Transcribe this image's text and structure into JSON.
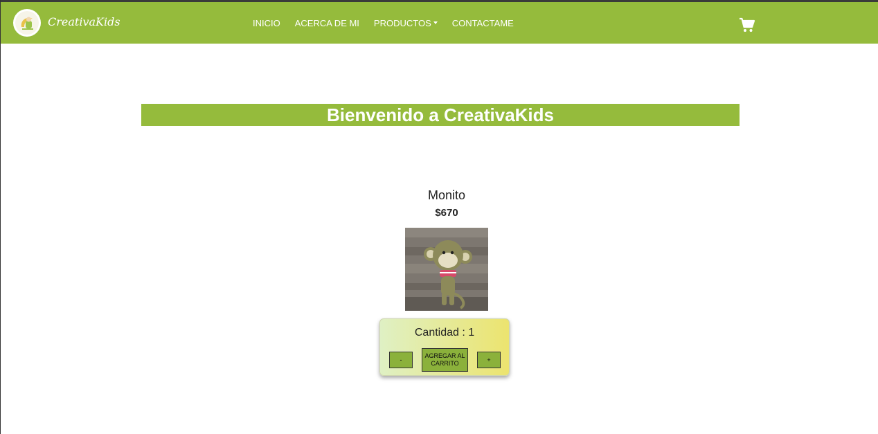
{
  "brand": {
    "name": "CreativaKids"
  },
  "nav": {
    "items": [
      "INICIO",
      "ACERCA DE MI",
      "PRODUCTOS",
      "CONTACTAME"
    ]
  },
  "hero": {
    "title": "Bienvenido a CreativaKids"
  },
  "product": {
    "name": "Monito",
    "price": "$670",
    "quantity_text": "Cantidad : 1",
    "minus_label": "-",
    "add_to_cart_label": "AGREGAR AL CARRITO",
    "plus_label": "+"
  },
  "colors": {
    "brand_green": "#95bb3c",
    "button_green": "#8bb13b",
    "card_gradient_start": "#dff0c4",
    "card_gradient_end": "#ece46f"
  },
  "icons": [
    "logo-icon",
    "chevron-down-icon",
    "shopping-cart-icon"
  ]
}
